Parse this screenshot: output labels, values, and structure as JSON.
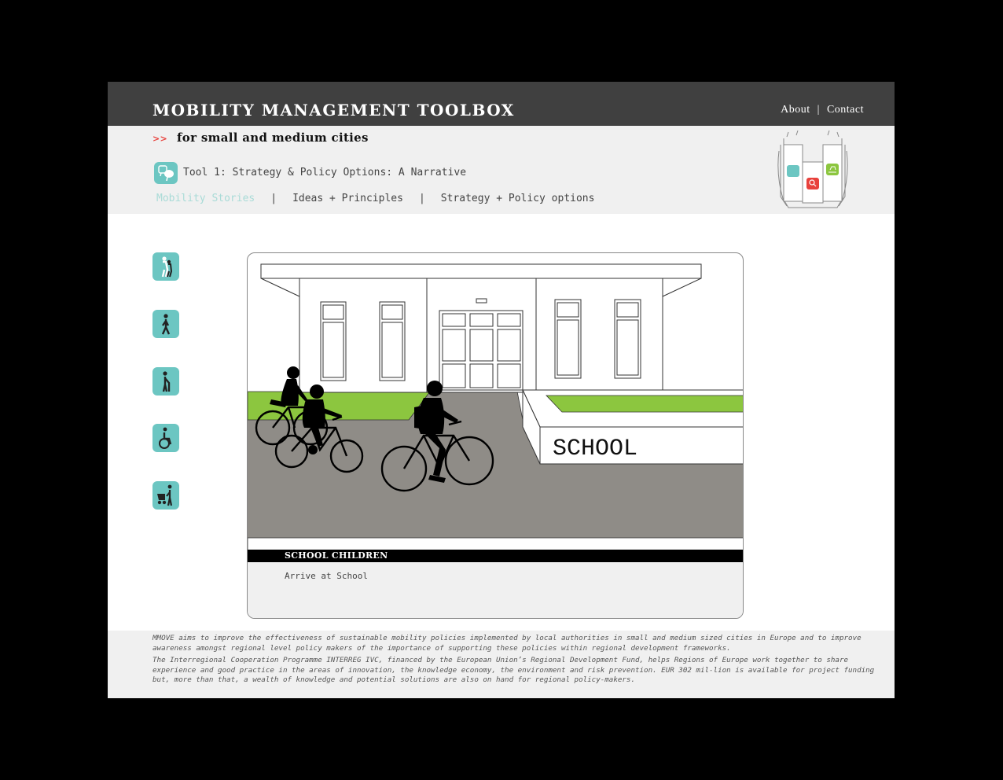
{
  "header": {
    "title": "MOBILITY MANAGEMENT TOOLBOX",
    "links": {
      "about": "About",
      "separator": "|",
      "contact": "Contact"
    }
  },
  "subheader": {
    "tagline_arrow": ">>",
    "tagline": "for small and medium cities",
    "tool_label": "Tool 1: Strategy & Policy Options: A Narrative",
    "nav": [
      {
        "label": "Mobility Stories",
        "active": true
      },
      {
        "label": "Ideas + Principles",
        "active": false
      },
      {
        "label": "Strategy + Policy options",
        "active": false
      }
    ],
    "nav_separator": "|"
  },
  "sidebar": {
    "icons": [
      "walking-group-icon",
      "pedestrian-icon",
      "elderly-cane-icon",
      "wheelchair-icon",
      "stroller-icon"
    ]
  },
  "story": {
    "scene_sign": "SCHOOL",
    "caption_title": "SCHOOL CHILDREN",
    "caption_text": "Arrive at School"
  },
  "footer": {
    "paragraph1": "MMOVE aims to improve the effectiveness of sustainable mobility policies implemented by local authorities in small and medium sized cities in Europe and to improve awareness amongst regional level policy makers of the importance of supporting these policies within regional development frameworks.",
    "paragraph2": "The Interregional Cooperation Programme INTERREG IVC, financed by the European Union’s Regional Development Fund, helps Regions of Europe work together to share experience and good practice in the areas of innovation, the knowledge economy, the environment and risk prevention. EUR 302 mil-lion is available for project funding but, more than that, a wealth of knowledge and potential solutions are also on hand for regional policy-makers."
  },
  "colors": {
    "topbar": "#404040",
    "subheader": "#f0f0f0",
    "accent_teal": "#6cc6c2",
    "active_nav": "#a9dbd7",
    "arrow_red": "#e8413c",
    "grass_green": "#8cc63f",
    "road_gray": "#8f8c87"
  }
}
